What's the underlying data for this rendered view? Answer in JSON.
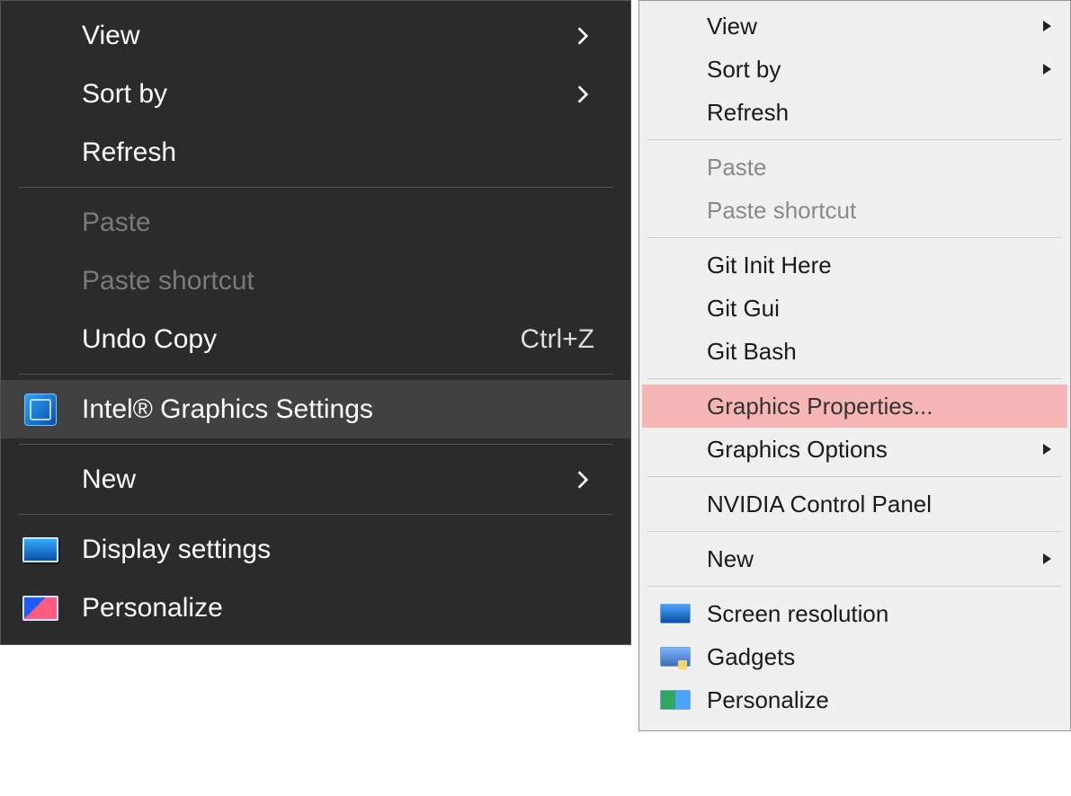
{
  "dark_menu": {
    "items": [
      {
        "label": "View",
        "submenu": true,
        "enabled": true
      },
      {
        "label": "Sort by",
        "submenu": true,
        "enabled": true
      },
      {
        "label": "Refresh",
        "submenu": false,
        "enabled": true
      },
      {
        "sep": true
      },
      {
        "label": "Paste",
        "submenu": false,
        "enabled": false
      },
      {
        "label": "Paste shortcut",
        "submenu": false,
        "enabled": false
      },
      {
        "label": "Undo Copy",
        "submenu": false,
        "enabled": true,
        "shortcut": "Ctrl+Z"
      },
      {
        "sep": true
      },
      {
        "label": "Intel® Graphics Settings",
        "submenu": false,
        "enabled": true,
        "icon": "intel",
        "highlight": true
      },
      {
        "sep": true
      },
      {
        "label": "New",
        "submenu": true,
        "enabled": true
      },
      {
        "sep": true
      },
      {
        "label": "Display settings",
        "submenu": false,
        "enabled": true,
        "icon": "display"
      },
      {
        "label": "Personalize",
        "submenu": false,
        "enabled": true,
        "icon": "personalize"
      }
    ]
  },
  "light_menu": {
    "items": [
      {
        "label": "View",
        "submenu": true,
        "enabled": true
      },
      {
        "label": "Sort by",
        "submenu": true,
        "enabled": true
      },
      {
        "label": "Refresh",
        "submenu": false,
        "enabled": true
      },
      {
        "sep": true
      },
      {
        "label": "Paste",
        "submenu": false,
        "enabled": false
      },
      {
        "label": "Paste shortcut",
        "submenu": false,
        "enabled": false
      },
      {
        "sep": true
      },
      {
        "label": "Git Init Here",
        "submenu": false,
        "enabled": true
      },
      {
        "label": "Git Gui",
        "submenu": false,
        "enabled": true
      },
      {
        "label": "Git Bash",
        "submenu": false,
        "enabled": true
      },
      {
        "sep": true
      },
      {
        "label": "Graphics Properties...",
        "submenu": false,
        "enabled": true,
        "highlight_pink": true
      },
      {
        "label": "Graphics Options",
        "submenu": true,
        "enabled": true
      },
      {
        "sep": true
      },
      {
        "label": "NVIDIA Control Panel",
        "submenu": false,
        "enabled": true
      },
      {
        "sep": true
      },
      {
        "label": "New",
        "submenu": true,
        "enabled": true
      },
      {
        "sep": true
      },
      {
        "label": "Screen resolution",
        "submenu": false,
        "enabled": true,
        "icon": "screen"
      },
      {
        "label": "Gadgets",
        "submenu": false,
        "enabled": true,
        "icon": "gadgets"
      },
      {
        "label": "Personalize",
        "submenu": false,
        "enabled": true,
        "icon": "personalize2"
      }
    ]
  }
}
